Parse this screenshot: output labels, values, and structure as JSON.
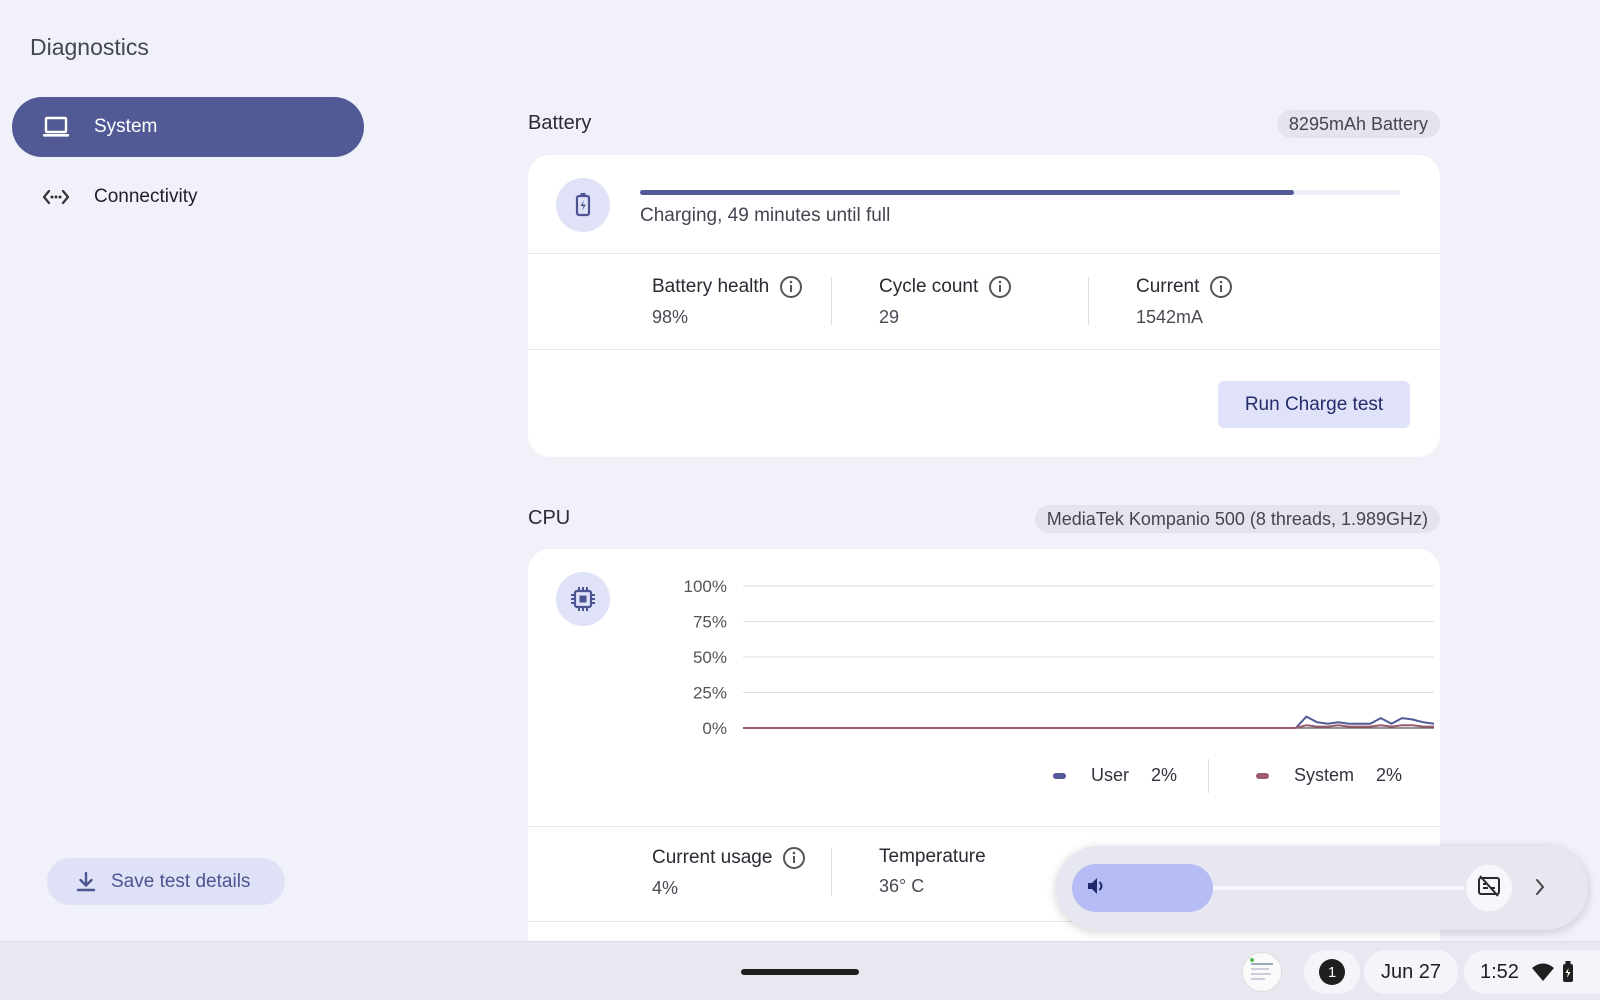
{
  "app": {
    "title": "Diagnostics"
  },
  "sidebar": {
    "items": [
      {
        "label": "System",
        "icon": "laptop-icon",
        "active": true
      },
      {
        "label": "Connectivity",
        "icon": "connectivity-icon",
        "active": false
      }
    ],
    "save_button": "Save test details"
  },
  "battery": {
    "title": "Battery",
    "chip": "8295mAh Battery",
    "status": "Charging, 49 minutes until full",
    "charge_percent": 86,
    "metrics": [
      {
        "label": "Battery health",
        "value": "98%"
      },
      {
        "label": "Cycle count",
        "value": "29"
      },
      {
        "label": "Current",
        "value": "1542mA"
      }
    ],
    "run_button": "Run Charge test"
  },
  "cpu": {
    "title": "CPU",
    "chip": "MediaTek Kompanio 500 (8 threads, 1.989GHz)",
    "legend": [
      {
        "label": "User",
        "value": "2%",
        "color": "#525a96"
      },
      {
        "label": "System",
        "value": "2%",
        "color": "#9a5b6e"
      }
    ],
    "metrics": [
      {
        "label": "Current usage",
        "value": "4%"
      },
      {
        "label": "Temperature",
        "value": "36° C"
      }
    ]
  },
  "chart_data": {
    "type": "line",
    "y_ticks": [
      "100%",
      "75%",
      "50%",
      "25%",
      "0%"
    ],
    "ylim": [
      0,
      100
    ],
    "grid": true,
    "series": [
      {
        "name": "User",
        "color": "#525a96",
        "values": [
          0,
          0,
          0,
          0,
          0,
          0,
          0,
          0,
          0,
          0,
          0,
          0,
          0,
          0,
          0,
          0,
          0,
          0,
          0,
          0,
          0,
          0,
          0,
          0,
          0,
          0,
          0,
          0,
          0,
          0,
          0,
          0,
          0,
          0,
          0,
          0,
          0,
          0,
          0,
          0,
          0,
          0,
          0,
          0,
          0,
          0,
          0,
          0,
          0,
          0,
          0,
          0,
          0,
          8,
          4,
          3,
          4,
          3,
          3,
          3,
          7,
          3,
          7,
          6,
          4,
          3
        ]
      },
      {
        "name": "System",
        "color": "#9a5b6e",
        "values": [
          0,
          0,
          0,
          0,
          0,
          0,
          0,
          0,
          0,
          0,
          0,
          0,
          0,
          0,
          0,
          0,
          0,
          0,
          0,
          0,
          0,
          0,
          0,
          0,
          0,
          0,
          0,
          0,
          0,
          0,
          0,
          0,
          0,
          0,
          0,
          0,
          0,
          0,
          0,
          0,
          0,
          0,
          0,
          0,
          0,
          0,
          0,
          0,
          0,
          0,
          0,
          0,
          0,
          2,
          1,
          1,
          2,
          1,
          1,
          1,
          2,
          1,
          2,
          2,
          1,
          1
        ]
      }
    ]
  },
  "shelf": {
    "notification_count": "1",
    "date": "Jun 27",
    "time": "1:52"
  },
  "volume": {
    "level_percent": 36
  }
}
